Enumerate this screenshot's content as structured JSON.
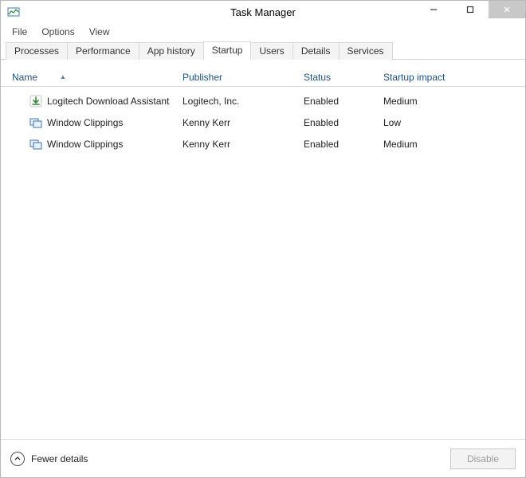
{
  "window": {
    "title": "Task Manager"
  },
  "menubar": {
    "items": [
      "File",
      "Options",
      "View"
    ]
  },
  "tabs": {
    "items": [
      "Processes",
      "Performance",
      "App history",
      "Startup",
      "Users",
      "Details",
      "Services"
    ],
    "active_index": 3
  },
  "columns": {
    "name": "Name",
    "publisher": "Publisher",
    "status": "Status",
    "impact": "Startup impact",
    "sort_indicator": "▲"
  },
  "rows": [
    {
      "icon": "download-icon",
      "name": "Logitech Download Assistant",
      "publisher": "Logitech, Inc.",
      "status": "Enabled",
      "impact": "Medium"
    },
    {
      "icon": "app-icon",
      "name": "Window Clippings",
      "publisher": "Kenny Kerr",
      "status": "Enabled",
      "impact": "Low"
    },
    {
      "icon": "app-icon",
      "name": "Window Clippings",
      "publisher": "Kenny Kerr",
      "status": "Enabled",
      "impact": "Medium"
    }
  ],
  "footer": {
    "fewer_details": "Fewer details",
    "disable": "Disable"
  },
  "window_controls": {
    "minimize": "—",
    "maximize": "□",
    "close": "✕"
  }
}
